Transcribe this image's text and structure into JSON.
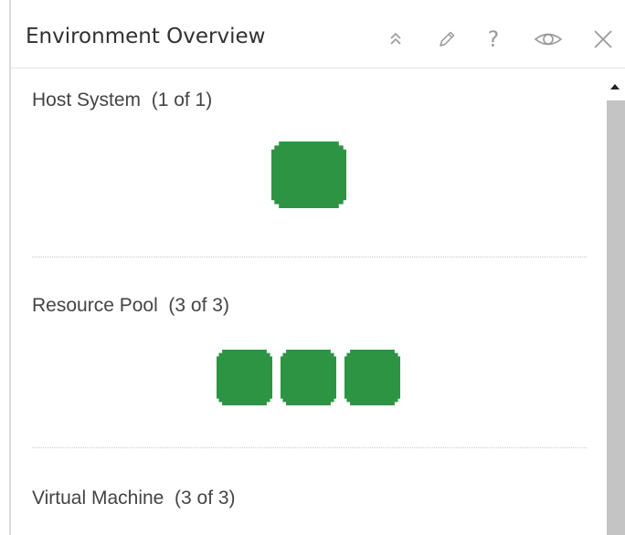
{
  "panel": {
    "title": "Environment Overview"
  },
  "toolbar": {
    "icons": [
      "collapse-icon",
      "pencil-icon",
      "help-icon",
      "eye-icon",
      "close-icon"
    ],
    "help_glyph": "?"
  },
  "sections": [
    {
      "label": "Host System  (1 of 1)",
      "count": 1,
      "status_color": "#2d9444"
    },
    {
      "label": "Resource Pool  (3 of 3)",
      "count": 3,
      "status_color": "#2d9444"
    },
    {
      "label": "Virtual Machine  (3 of 3)",
      "count": 3,
      "status_color": "#2d9444"
    }
  ],
  "colors": {
    "healthy": "#2d9444",
    "scroll_thumb": "#c4c4c4"
  }
}
